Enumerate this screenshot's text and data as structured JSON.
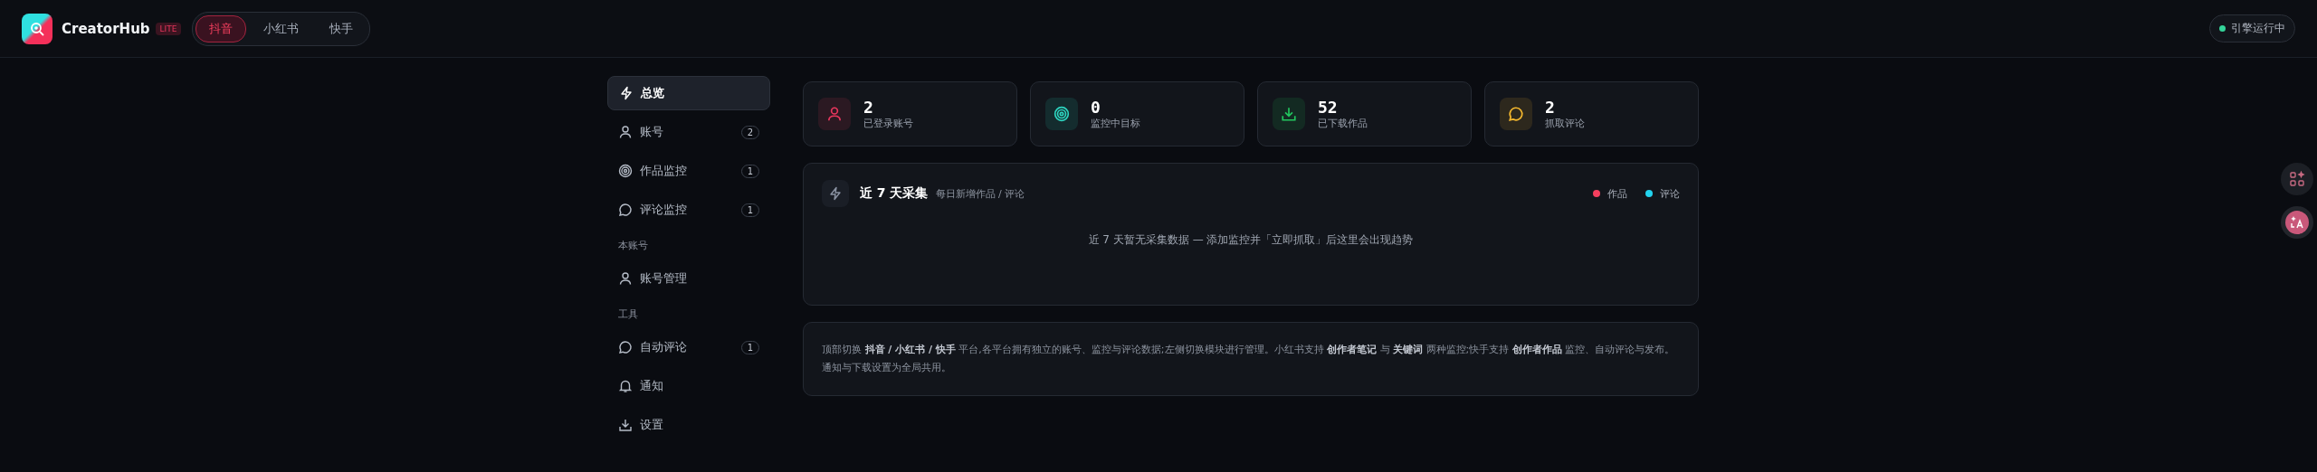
{
  "header": {
    "brand": "CreatorHub",
    "badge": "LITE",
    "platforms": [
      {
        "label": "抖音",
        "selected": true
      },
      {
        "label": "小红书",
        "selected": false
      },
      {
        "label": "快手",
        "selected": false
      }
    ],
    "status": {
      "label": "引擎运行中",
      "on": true
    }
  },
  "sidebar": {
    "sections": [
      {
        "items": [
          {
            "label": "总览",
            "selected": true
          },
          {
            "label": "账号",
            "count": "2",
            "selected": false
          },
          {
            "label": "作品监控",
            "count": "1",
            "selected": false
          },
          {
            "label": "评论监控",
            "count": "1",
            "selected": false
          }
        ]
      },
      {
        "heading": "本账号",
        "items": [
          {
            "label": "账号管理",
            "selected": false
          }
        ]
      },
      {
        "heading": "工具",
        "items": [
          {
            "label": "自动评论",
            "count": "1",
            "selected": false
          },
          {
            "label": "通知",
            "selected": false
          },
          {
            "label": "设置",
            "selected": false
          }
        ]
      }
    ]
  },
  "stats": [
    {
      "value": "2",
      "label": "已登录账号",
      "color": "#e8365d"
    },
    {
      "value": "0",
      "label": "监控中目标",
      "color": "#2dd4bf"
    },
    {
      "value": "52",
      "label": "已下载作品",
      "color": "#22c55e"
    },
    {
      "value": "2",
      "label": "抓取评论",
      "color": "#f5b82e"
    }
  ],
  "trend": {
    "title": "近 7 天采集",
    "subtitle": "每日新增作品 / 评论",
    "legend": [
      {
        "label": "作品",
        "color": "#f43f5e"
      },
      {
        "label": "评论",
        "color": "#22d3ee"
      }
    ],
    "empty": "近 7 天暂无采集数据 — 添加监控并「立即抓取」后这里会出现趋势"
  },
  "notice": "顶部切换 **抖音 / 小红书 / 快手** 平台,各平台拥有独立的账号、监控与评论数据;左侧切换模块进行管理。小红书支持 **创作者笔记** 与 **关键词** 两种监控;快手支持 **创作者作品** 监控、自动评论与发布。通知与下载设置为全局共用。"
}
